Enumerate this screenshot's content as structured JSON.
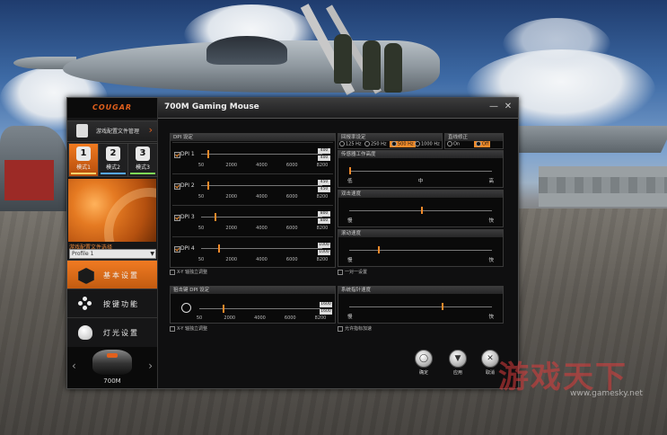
{
  "app": {
    "logo": "COUGAR",
    "title": "700M Gaming Mouse",
    "minimize": "—",
    "close": "✕"
  },
  "sidebar": {
    "profile_manager": "游戏配置文件管理",
    "modes": [
      {
        "num": "1",
        "label": "模式1",
        "active": true
      },
      {
        "num": "2",
        "label": "模式2",
        "active": false
      },
      {
        "num": "3",
        "label": "模式3",
        "active": false
      }
    ],
    "profile_caption": "游戏配置文件选择",
    "profile_selected": "Profile 1",
    "nav": [
      {
        "label": "基本设置",
        "icon": "hexagon-settings-icon",
        "active": true
      },
      {
        "label": "按键功能",
        "icon": "buttons-dots-icon",
        "active": false
      },
      {
        "label": "灯光设置",
        "icon": "lightbulb-icon",
        "active": false
      }
    ],
    "mouse_name": "700M"
  },
  "dpi": {
    "header": "DPI 设定",
    "rows": [
      {
        "label": "DPI 1",
        "checked": true,
        "value_top": "400",
        "value_bottom": "400",
        "level": 0.05
      },
      {
        "label": "DPI 2",
        "checked": true,
        "value_top": "450",
        "value_bottom": "450",
        "level": 0.055
      },
      {
        "label": "DPI 3",
        "checked": true,
        "value_top": "800",
        "value_bottom": "800",
        "level": 0.11
      },
      {
        "label": "DPI 4",
        "checked": true,
        "value_top": "1000",
        "value_bottom": "1000",
        "level": 0.14
      }
    ],
    "ticks": [
      "50",
      "2000",
      "4000",
      "6000",
      "8200"
    ],
    "xy_option": "X-Y 轴独立调整"
  },
  "sniper": {
    "header": "狙击键 DPI 设定",
    "value_top": "1600",
    "value_bottom": "1600",
    "level": 0.19,
    "ticks": [
      "50",
      "2000",
      "4000",
      "6000",
      "8200"
    ],
    "xy_option": "X-Y 轴独立调整"
  },
  "polling": {
    "header": "回报率设定",
    "options": [
      "125 Hz",
      "250 Hz",
      "500 Hz",
      "1000 Hz"
    ],
    "selected": "500 Hz"
  },
  "angle_snap": {
    "header": "直线修正",
    "options": [
      "On",
      "Off"
    ],
    "selected": "Off"
  },
  "sliders": [
    {
      "header": "传感器工作高度",
      "left": "低",
      "middle": "中",
      "right": "高",
      "level": 0.0
    },
    {
      "header": "双击速度",
      "left": "慢",
      "middle": "",
      "right": "快",
      "level": 0.5
    },
    {
      "header": "滚动速度",
      "left": "慢",
      "middle": "",
      "right": "快",
      "level": 0.2
    }
  ],
  "one_to_one": "一对一设置",
  "pointer": {
    "header": "系统指针速度",
    "left": "慢",
    "right": "快",
    "level": 0.65,
    "accel_option": "允许指标加速"
  },
  "bottom_buttons": [
    {
      "label": "确定",
      "icon": "confirm-circle-icon",
      "glyph": "◯"
    },
    {
      "label": "应用",
      "icon": "apply-arrow-icon",
      "glyph": "▼"
    },
    {
      "label": "取消",
      "icon": "cancel-x-icon",
      "glyph": "✕"
    }
  ],
  "watermark": {
    "text": "游戏天下",
    "url": "www.gamesky.net"
  },
  "colors": {
    "accent": "#f08a2a",
    "brand": "#e2601c",
    "window_bg": "#0f0f10"
  }
}
